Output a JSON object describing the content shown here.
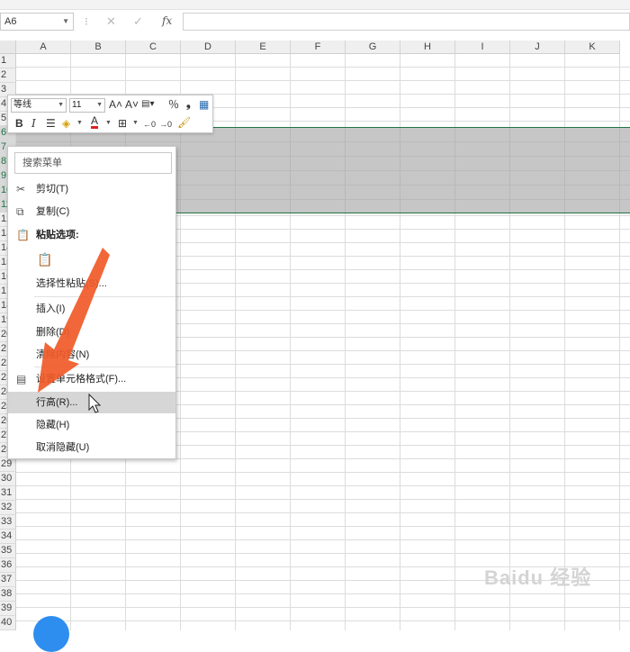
{
  "formula_bar": {
    "name_box": "A6",
    "cancel_glyph": "✕",
    "enter_glyph": "✓",
    "fx_label": "fx",
    "formula_value": ""
  },
  "sheet": {
    "columns": [
      "A",
      "B",
      "C",
      "D",
      "E",
      "F",
      "G",
      "H",
      "I",
      "J",
      "K"
    ],
    "rows": [
      "1",
      "2",
      "3",
      "4",
      "5",
      "6",
      "7",
      "8",
      "9",
      "10",
      "11",
      "12",
      "13",
      "14",
      "15",
      "16",
      "17",
      "18",
      "19",
      "20",
      "21",
      "22",
      "23",
      "24",
      "25",
      "26",
      "27",
      "28",
      "29",
      "30",
      "31",
      "32",
      "33",
      "34",
      "35",
      "36",
      "37",
      "38",
      "39",
      "40"
    ],
    "selected_rows": [
      "6",
      "7",
      "8",
      "9",
      "10",
      "11"
    ]
  },
  "mini_toolbar": {
    "font": "等线",
    "size": "11",
    "grow_font": "A˄",
    "shrink_font": "A˅",
    "format_glyph": "％",
    "comma_glyph": "❟",
    "bold": "B",
    "italic": "I",
    "font_color": "A",
    "icons": [
      "increase-font-icon",
      "decrease-font-icon",
      "accounting-format-icon",
      "percent-icon",
      "comma-style-icon",
      "table-style-icon",
      "bold-icon",
      "italic-icon",
      "align-icon",
      "fill-color-icon",
      "font-color-icon",
      "borders-icon",
      "decrease-decimal-icon",
      "increase-decimal-icon",
      "format-painter-icon"
    ]
  },
  "context_menu": {
    "search_placeholder": "搜索菜单",
    "items": {
      "cut": "剪切(T)",
      "copy": "复制(C)",
      "paste_options": "粘贴选项:",
      "paste_special": "选择性粘贴(S)...",
      "insert": "插入(I)",
      "delete": "删除(D)",
      "clear_contents": "清除内容(N)",
      "format_cells": "设置单元格格式(F)...",
      "row_height": "行高(R)...",
      "hide": "隐藏(H)",
      "unhide": "取消隐藏(U)"
    }
  },
  "colors": {
    "selection_fill": "#c6c6c6",
    "selection_border": "#217346",
    "arrow": "#f05a28",
    "highlight": "#d6d6d6"
  },
  "watermark": "Baidu 经验"
}
